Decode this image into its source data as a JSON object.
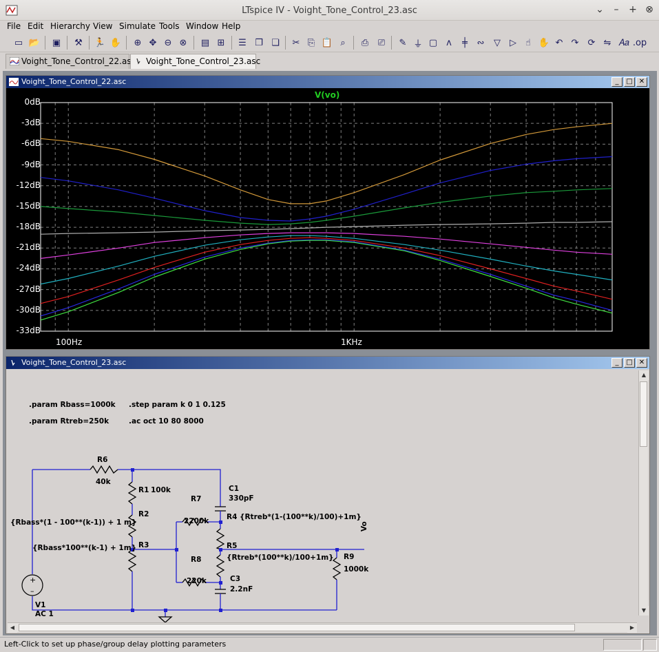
{
  "window": {
    "title": "LTspice IV - Voight_Tone_Control_23.asc"
  },
  "menu": [
    "File",
    "Edit",
    "Hierarchy",
    "View",
    "Simulate",
    "Tools",
    "Window",
    "Help"
  ],
  "tabs": [
    {
      "label": "Voight_Tone_Control_22.asc",
      "active": false,
      "icon": "waveform-icon"
    },
    {
      "label": "Voight_Tone_Control_23.asc",
      "active": true,
      "icon": "schematic-icon"
    }
  ],
  "plot_window": {
    "title": "Voight_Tone_Control_22.asc",
    "trace_name": "V(vo)",
    "colors": {
      "background": "#000000",
      "grid": "#808080",
      "axis": "#ffffff",
      "trace_label": "#22cc22"
    }
  },
  "chart_data": {
    "type": "line",
    "x_scale": "log",
    "xlim": [
      80,
      8000
    ],
    "ylim": [
      -33,
      0
    ],
    "y_ticks": [
      "0dB",
      "-3dB",
      "-6dB",
      "-9dB",
      "-12dB",
      "-15dB",
      "-18dB",
      "-21dB",
      "-24dB",
      "-27dB",
      "-30dB",
      "-33dB"
    ],
    "x_ticks": [
      "100Hz",
      "1KHz"
    ],
    "grid": true,
    "x": [
      80,
      100,
      150,
      200,
      300,
      400,
      500,
      600,
      700,
      800,
      1000,
      1500,
      2000,
      3000,
      4000,
      5000,
      6000,
      8000
    ],
    "series": [
      {
        "color": "#d49a3a",
        "values": [
          -5.2,
          -5.6,
          -6.8,
          -8.2,
          -10.6,
          -12.6,
          -14.0,
          -14.6,
          -14.6,
          -14.2,
          -13.0,
          -10.4,
          -8.3,
          -5.9,
          -4.6,
          -3.9,
          -3.5,
          -3.0
        ]
      },
      {
        "color": "#2020cc",
        "values": [
          -10.8,
          -11.3,
          -12.6,
          -13.8,
          -15.6,
          -16.6,
          -17.0,
          -17.1,
          -16.8,
          -16.4,
          -15.4,
          -13.2,
          -11.6,
          -9.8,
          -8.9,
          -8.4,
          -8.1,
          -7.8
        ]
      },
      {
        "color": "#1a9a3a",
        "values": [
          -15.0,
          -15.3,
          -15.8,
          -16.3,
          -17.0,
          -17.4,
          -17.6,
          -17.5,
          -17.3,
          -17.0,
          -16.4,
          -15.2,
          -14.4,
          -13.5,
          -13.0,
          -12.8,
          -12.6,
          -12.4
        ]
      },
      {
        "color": "#b0b0b0",
        "values": [
          -19.0,
          -18.9,
          -18.8,
          -18.7,
          -18.5,
          -18.4,
          -18.3,
          -18.2,
          -18.1,
          -18.0,
          -17.9,
          -17.7,
          -17.6,
          -17.5,
          -17.4,
          -17.3,
          -17.3,
          -17.2
        ]
      },
      {
        "color": "#e040e0",
        "values": [
          -22.5,
          -22.0,
          -21.0,
          -20.2,
          -19.5,
          -19.1,
          -18.9,
          -18.8,
          -18.8,
          -18.8,
          -18.9,
          -19.3,
          -19.7,
          -20.4,
          -20.9,
          -21.3,
          -21.6,
          -21.9
        ]
      },
      {
        "color": "#20b0c0",
        "values": [
          -26.2,
          -25.4,
          -23.6,
          -22.2,
          -20.6,
          -19.8,
          -19.4,
          -19.2,
          -19.2,
          -19.3,
          -19.6,
          -20.5,
          -21.3,
          -22.6,
          -23.6,
          -24.3,
          -24.8,
          -25.6
        ]
      },
      {
        "color": "#e02020",
        "values": [
          -29.0,
          -28.0,
          -25.6,
          -23.8,
          -21.6,
          -20.5,
          -19.9,
          -19.6,
          -19.5,
          -19.6,
          -19.9,
          -21.0,
          -22.1,
          -24.0,
          -25.4,
          -26.5,
          -27.2,
          -28.4
        ]
      },
      {
        "color": "#2828e0",
        "values": [
          -30.8,
          -29.6,
          -26.9,
          -24.8,
          -22.3,
          -21.0,
          -20.3,
          -19.9,
          -19.8,
          -19.8,
          -20.1,
          -21.3,
          -22.6,
          -24.8,
          -26.5,
          -27.8,
          -28.6,
          -30.0
        ]
      },
      {
        "color": "#40e040",
        "values": [
          -31.4,
          -30.2,
          -27.4,
          -25.2,
          -22.6,
          -21.2,
          -20.4,
          -20.0,
          -19.9,
          -19.9,
          -20.2,
          -21.4,
          -22.8,
          -25.1,
          -26.8,
          -28.2,
          -29.1,
          -30.4
        ]
      }
    ]
  },
  "schematic_window": {
    "title": "Voight_Tone_Control_23.asc",
    "directives": [
      ".param Rbass=1000k",
      ".step param k 0 1 0.125",
      ".param Rtreb=250k",
      ".ac oct 10 80 8000"
    ],
    "labels": {
      "r6": "R6",
      "r6_val": "40k",
      "r1": "R1",
      "r1_val": "100k",
      "r2": "R2",
      "r2_expr": "{Rbass*(1 - 100**(k-1)) + 1 m}",
      "r3": "R3",
      "r3_expr": "{Rbass*100**(k-1) + 1m}",
      "c1": "C1",
      "c1_val": "330pF",
      "r7": "R7",
      "r7_val": "2200k",
      "r4": "R4",
      "r4_expr": "{Rtreb*(1-(100**k)/100)+1m}",
      "r5": "R5",
      "r5_expr": "{Rtreb*(100**k)/100+1m}",
      "r8": "R8",
      "r8_val": "220k",
      "c3": "C3",
      "c3_val": "2.2nF",
      "r9": "R9",
      "r9_val": "1000k",
      "v1": "V1",
      "v1_val": "AC 1",
      "vo": "Vo"
    }
  },
  "status": {
    "message": "Left-Click to set up phase/group delay plotting parameters"
  }
}
